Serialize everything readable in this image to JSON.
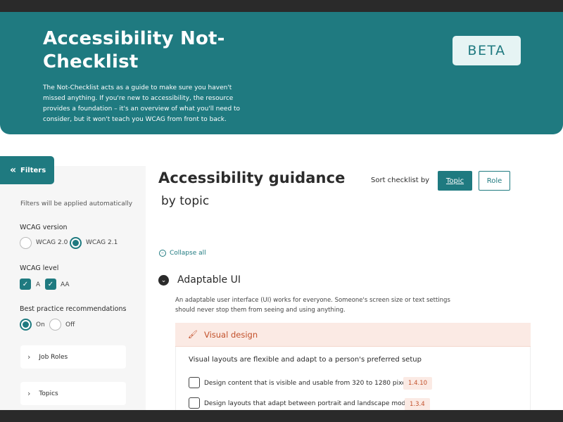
{
  "header": {
    "title": "Accessibility Not-Checklist",
    "description": "The Not-Checklist acts as a guide to make sure you haven't missed anything. If you're new to accessibility, the resource provides a foundation – it's an overview of what you'll need to consider, but it won't teach you WCAG from front to back.",
    "badge": "BETA"
  },
  "sidebar": {
    "filters_button": "Filters",
    "filters_icon": "double-chevron-left-icon",
    "note": "Filters will be applied automatically",
    "wcag_version": {
      "label": "WCAG version",
      "options": [
        {
          "label": "WCAG 2.0",
          "selected": false
        },
        {
          "label": "WCAG 2.1",
          "selected": true
        }
      ]
    },
    "wcag_level": {
      "label": "WCAG level",
      "options": [
        {
          "label": "A",
          "checked": true
        },
        {
          "label": "AA",
          "checked": true
        }
      ]
    },
    "best_practice": {
      "label": "Best practice recommendations",
      "options": [
        {
          "label": "On",
          "selected": true
        },
        {
          "label": "Off",
          "selected": false
        }
      ]
    },
    "groups": [
      {
        "label": "Job Roles"
      },
      {
        "label": "Topics"
      }
    ]
  },
  "main": {
    "title": "Accessibility guidance",
    "subtitle": "by topic",
    "sort": {
      "label": "Sort checklist by",
      "options": [
        {
          "label": "Topic",
          "active": true
        },
        {
          "label": "Role",
          "active": false
        }
      ]
    },
    "collapse_all": "Collapse all",
    "section": {
      "title": "Adaptable UI",
      "description": "An adaptable user interface (UI) works for everyone. Someone's screen size or text settings should never stop them from seeing and using anything.",
      "card": {
        "title": "Visual design",
        "icon": "paintbrush-icon",
        "lead": "Visual layouts are flexible and adapt to a person's preferred setup",
        "items": [
          {
            "text": "Design content that is visible and usable from 320 to 1280 pixels",
            "code": "1.4.10",
            "checked": false
          },
          {
            "text": "Design layouts that adapt between portrait and landscape mode",
            "code": "1.3.4",
            "checked": false
          }
        ]
      }
    }
  },
  "colors": {
    "brand": "#1f7a80",
    "accent": "#c2502a",
    "accent_bg": "#fbeae4"
  }
}
